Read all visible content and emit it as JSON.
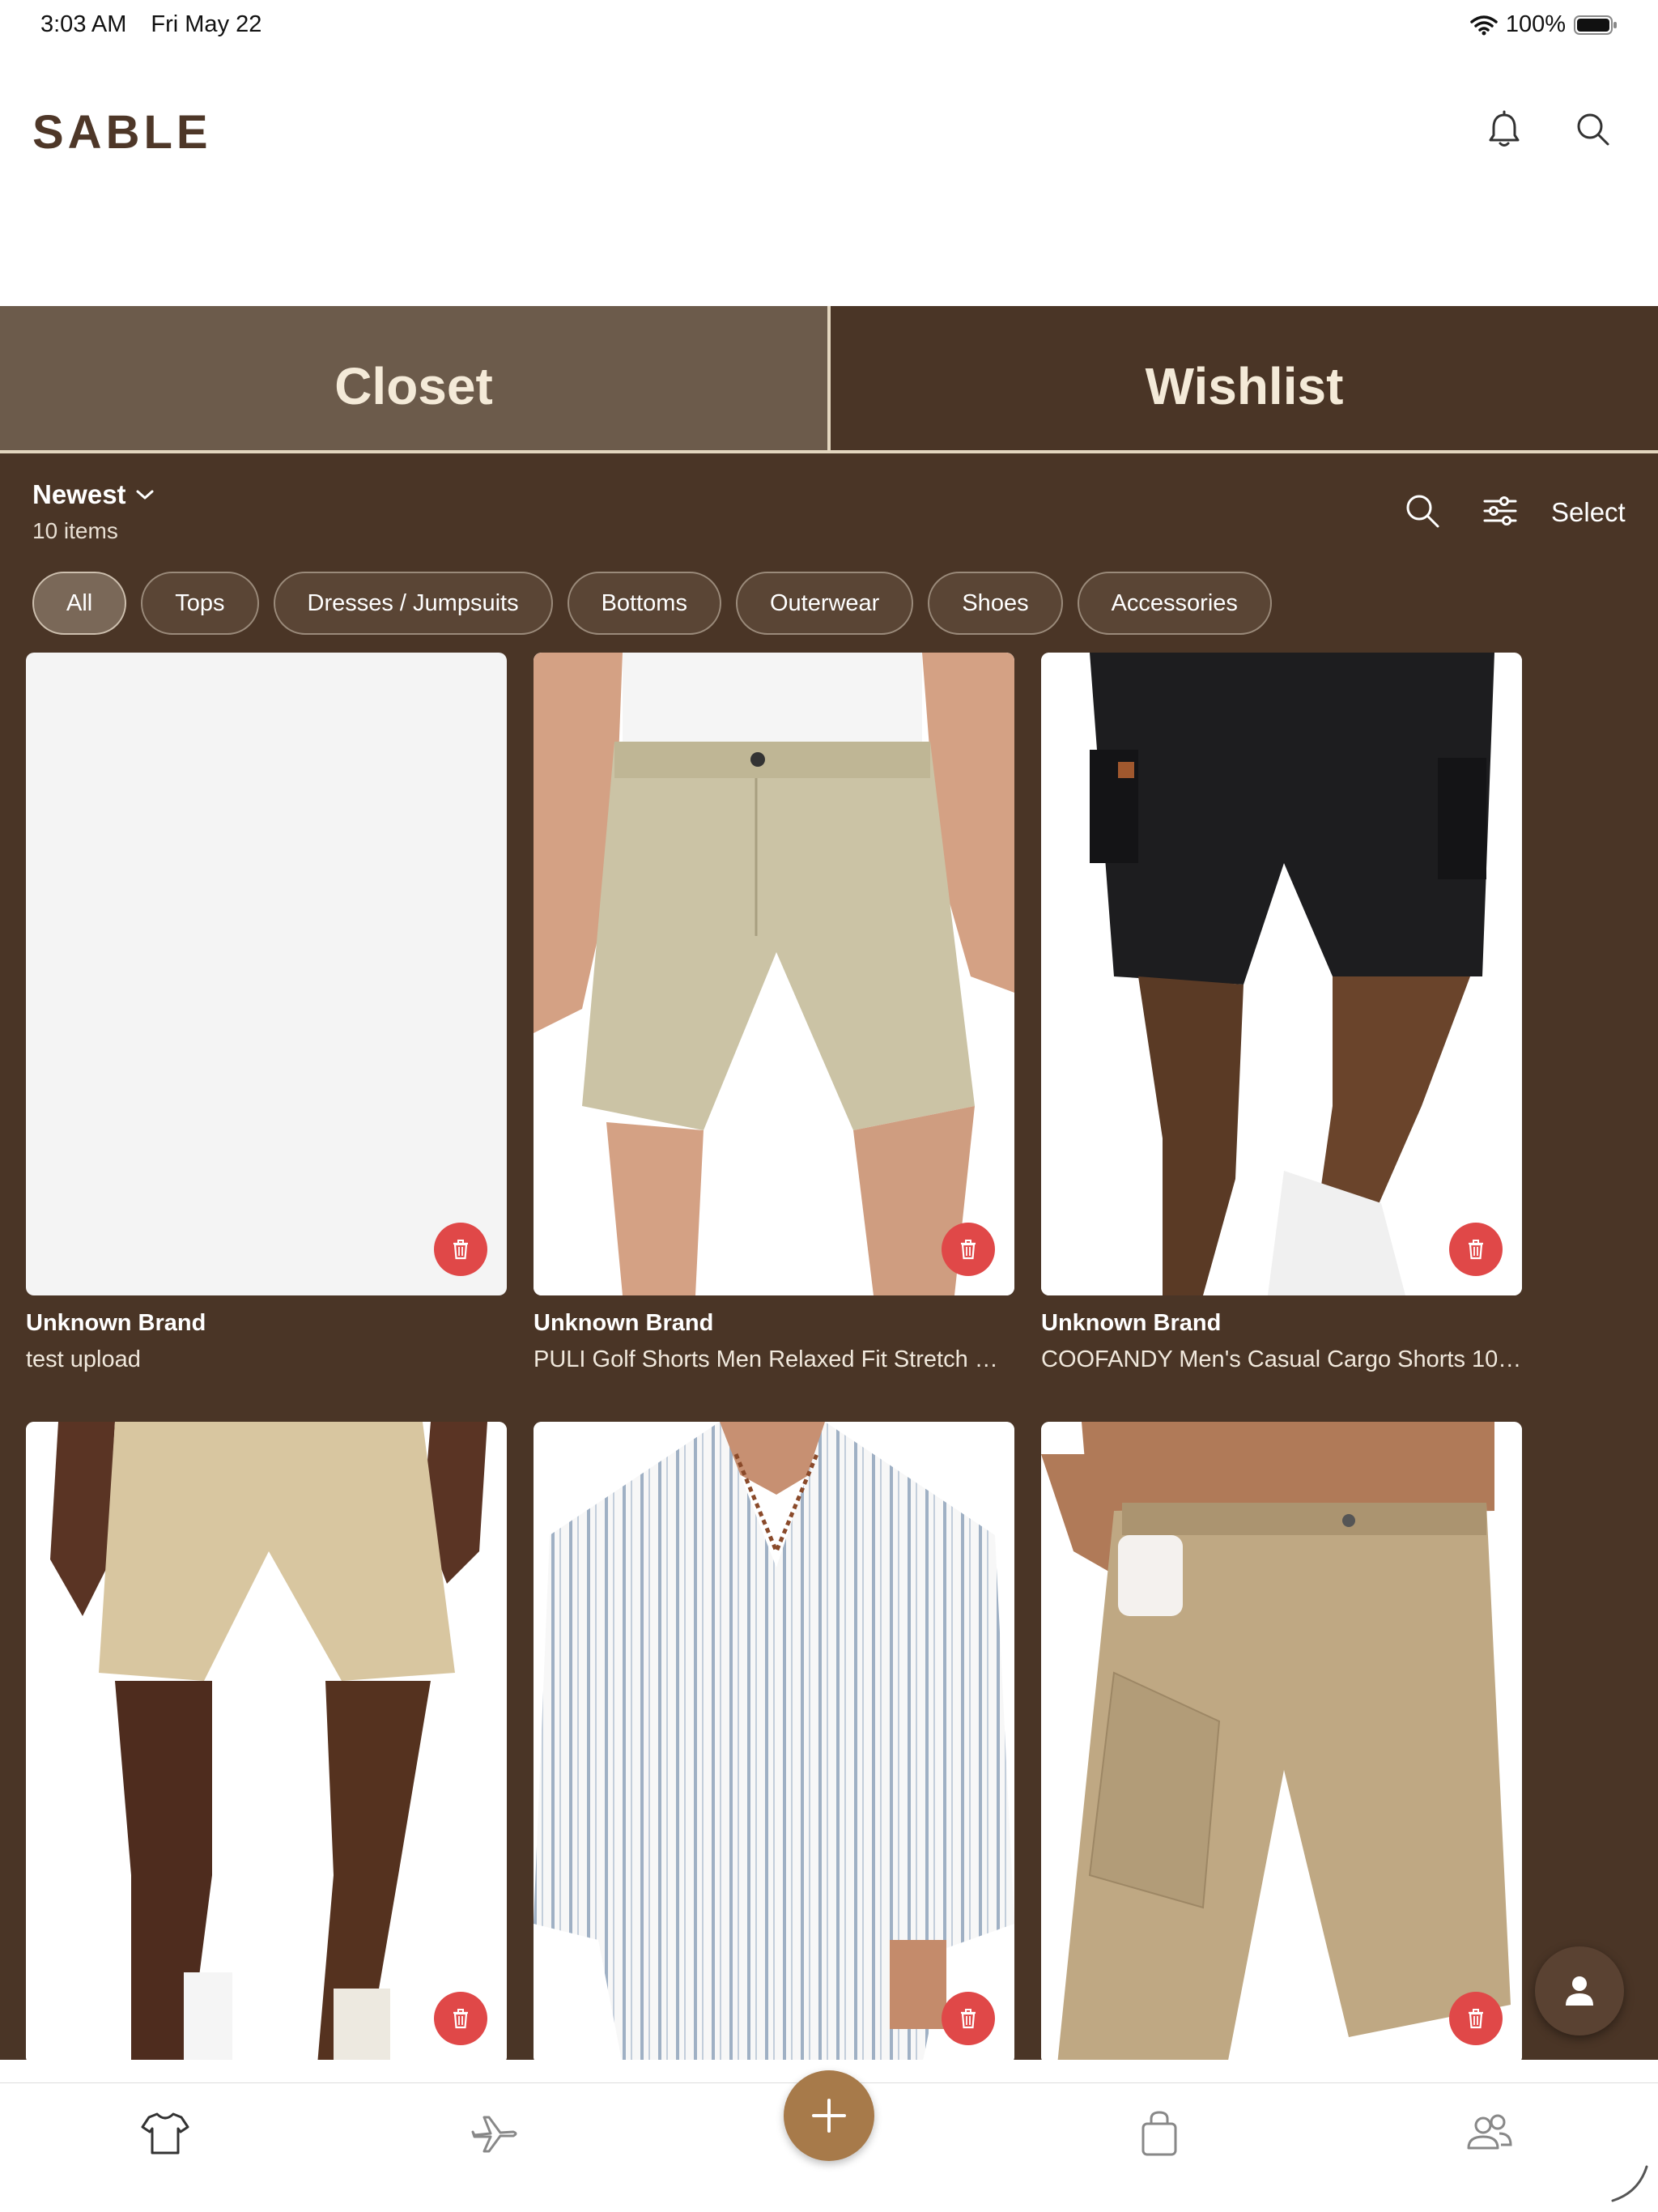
{
  "status": {
    "time": "3:03 AM",
    "date": "Fri May 22",
    "battery": "100%"
  },
  "header": {
    "logo": "SABLE"
  },
  "tabs": [
    {
      "label": "Closet",
      "active": true
    },
    {
      "label": "Wishlist",
      "active": false
    }
  ],
  "toolbar": {
    "sort_label": "Newest",
    "count_label": "10 items",
    "select_label": "Select"
  },
  "filters": [
    {
      "label": "All",
      "active": true
    },
    {
      "label": "Tops"
    },
    {
      "label": "Dresses / Jumpsuits"
    },
    {
      "label": "Bottoms"
    },
    {
      "label": "Outerwear"
    },
    {
      "label": "Shoes"
    },
    {
      "label": "Accessories"
    }
  ],
  "items": [
    {
      "brand": "Unknown Brand",
      "name": "test upload",
      "image": "blank-placeholder"
    },
    {
      "brand": "Unknown Brand",
      "name": "PULI Golf Shorts Men Relaxed Fit Stretch Dr...",
      "image": "khaki-chino-shorts"
    },
    {
      "brand": "Unknown Brand",
      "name": "COOFANDY Men's Casual Cargo Shorts 10\"...",
      "image": "black-cargo-shorts"
    },
    {
      "brand": "",
      "name": "",
      "image": "tan-chino-shorts"
    },
    {
      "brand": "",
      "name": "",
      "image": "striped-linen-shirt"
    },
    {
      "brand": "",
      "name": "",
      "image": "khaki-cargo-shorts"
    }
  ],
  "colors": {
    "brand": "#4e3728",
    "panel": "#4a3526",
    "closet_tab": "#6c5b4b",
    "delete": "#e04848",
    "add_button": "#a77a4a"
  },
  "icons": [
    "bell-icon",
    "search-icon",
    "filter-sliders-icon",
    "chevron-down-icon",
    "trash-icon",
    "profile-icon",
    "tshirt-icon",
    "airplane-icon",
    "plus-icon",
    "bag-icon",
    "friends-icon"
  ]
}
